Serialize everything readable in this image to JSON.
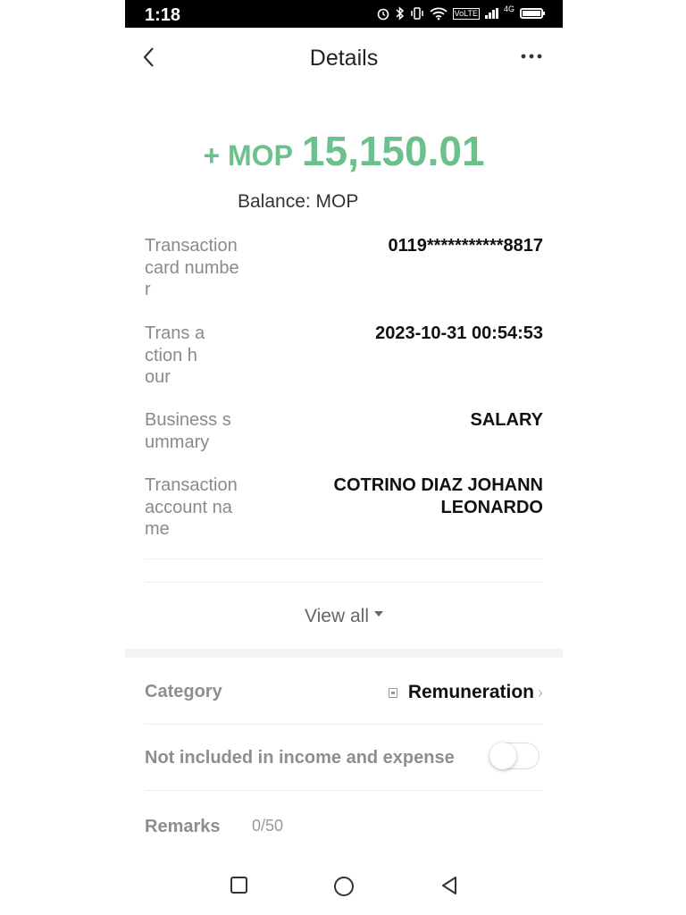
{
  "status_bar": {
    "time": "1:18",
    "net_tag": "VoLTE",
    "net_type": "4G"
  },
  "header": {
    "title": "Details"
  },
  "amount": {
    "currency": "+ MOP",
    "value": "15,150.01",
    "color": "#6cc08c"
  },
  "balance": "Balance: MOP",
  "details": [
    {
      "label": "Transaction card number",
      "value": "0119***********8817"
    },
    {
      "label": "Trans action hour",
      "value": "2023-10-31 00:54:53"
    },
    {
      "label": "Business summary",
      "value": "SALARY"
    },
    {
      "label": "Transaction account name",
      "value": "COTRINO DIAZ JOHANN LEONARDO"
    }
  ],
  "view_all": "View all",
  "category": {
    "label": "Category",
    "value": "Remuneration"
  },
  "exclude_toggle": {
    "label": "Not included in income and expense"
  },
  "remarks": {
    "label": "Remarks",
    "counter": "0/50"
  }
}
